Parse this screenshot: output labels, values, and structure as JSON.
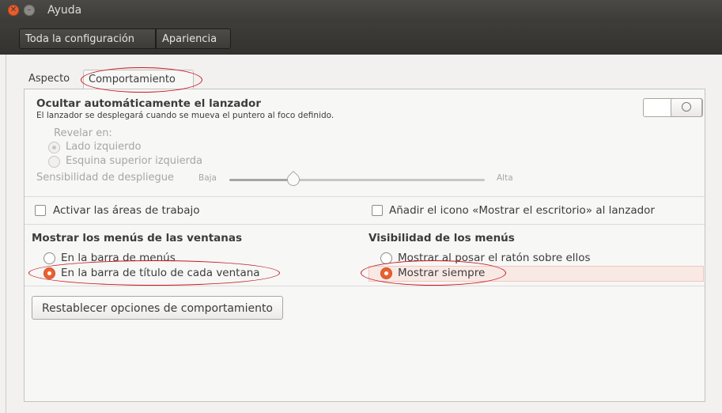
{
  "window": {
    "title": "Ayuda"
  },
  "toolbar": {
    "all_settings": "Toda la configuración",
    "appearance": "Apariencia"
  },
  "tabs": {
    "aspect": "Aspecto",
    "behavior": "Comportamiento"
  },
  "autohide": {
    "title": "Ocultar automáticamente el lanzador",
    "description": "El lanzador se desplegará cuando se mueva el puntero al foco definido.",
    "switch_state": "off",
    "reveal_label": "Revelar en:",
    "reveal_options": [
      "Lado izquierdo",
      "Esquina superior izquierda"
    ],
    "reveal_selected": "Lado izquierdo",
    "sensitivity_label": "Sensibilidad de despliegue",
    "sensitivity_low": "Baja",
    "sensitivity_high": "Alta",
    "sensitivity_value": 0.25
  },
  "checkboxes": {
    "workspaces": "Activar las áreas de trabajo",
    "show_desktop": "Añadir el icono «Mostrar el escritorio» al lanzador"
  },
  "menus": {
    "heading": "Mostrar los menús de las ventanas",
    "options": [
      "En la barra de menús",
      "En la barra de título de cada ventana"
    ],
    "selected": "En la barra de título de cada ventana"
  },
  "visibility": {
    "heading": "Visibilidad de los menús",
    "options": [
      "Mostrar al posar el ratón sobre ellos",
      "Mostrar siempre"
    ],
    "selected": "Mostrar siempre"
  },
  "reset_button": "Restablecer opciones de comportamiento",
  "colors": {
    "accent": "#e9622f",
    "annotation": "#c8161d",
    "titlebar": "#3c3b37"
  }
}
